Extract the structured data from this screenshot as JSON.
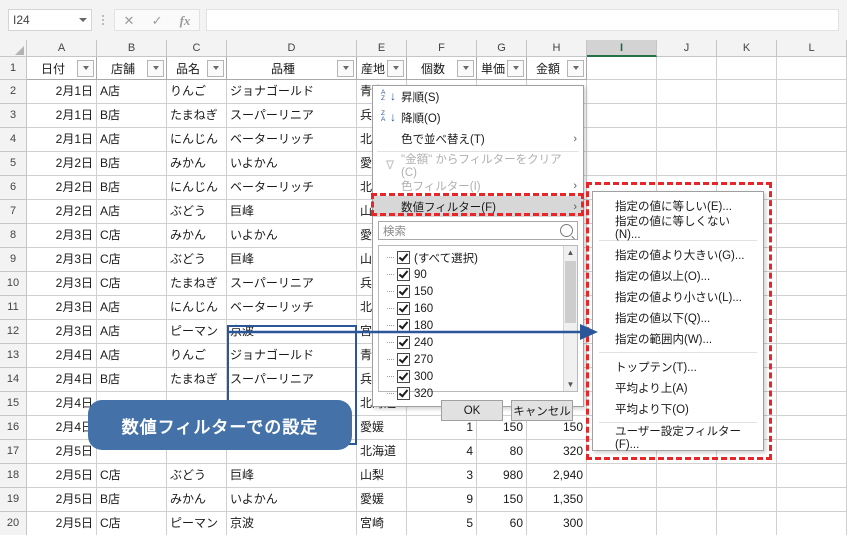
{
  "formula_bar": {
    "name_box_value": "I24",
    "formula_value": "",
    "cancel_icon": "close-icon",
    "confirm_icon": "check-icon",
    "function_icon": "fx-icon"
  },
  "grid": {
    "columns": [
      "A",
      "B",
      "C",
      "D",
      "E",
      "F",
      "G",
      "H",
      "I",
      "J",
      "K",
      "L"
    ],
    "selected_column": "I",
    "row_numbers": [
      1,
      2,
      3,
      4,
      5,
      6,
      7,
      8,
      9,
      10,
      11,
      12,
      13,
      14,
      15,
      16,
      17,
      18,
      19,
      20
    ],
    "headers": [
      "日付",
      "店舗",
      "品名",
      "品種",
      "産地",
      "個数",
      "単価",
      "金額"
    ],
    "rows": [
      {
        "r": 2,
        "date": "2月1日",
        "store": "A店",
        "item": "りんご",
        "variety": "ジョナゴールド",
        "origin": "青森",
        "qty": "",
        "price": "",
        "amount": ""
      },
      {
        "r": 3,
        "date": "2月1日",
        "store": "B店",
        "item": "たまねぎ",
        "variety": "スーパーリニア",
        "origin": "兵庫",
        "qty": "",
        "price": "",
        "amount": ""
      },
      {
        "r": 4,
        "date": "2月1日",
        "store": "A店",
        "item": "にんじん",
        "variety": "ベーターリッチ",
        "origin": "北海道",
        "qty": "",
        "price": "",
        "amount": ""
      },
      {
        "r": 5,
        "date": "2月2日",
        "store": "B店",
        "item": "みかん",
        "variety": "いよかん",
        "origin": "愛媛",
        "qty": "",
        "price": "",
        "amount": ""
      },
      {
        "r": 6,
        "date": "2月2日",
        "store": "B店",
        "item": "にんじん",
        "variety": "ベーターリッチ",
        "origin": "北海道",
        "qty": "",
        "price": "",
        "amount": ""
      },
      {
        "r": 7,
        "date": "2月2日",
        "store": "A店",
        "item": "ぶどう",
        "variety": "巨峰",
        "origin": "山梨",
        "qty": "",
        "price": "",
        "amount": ""
      },
      {
        "r": 8,
        "date": "2月3日",
        "store": "C店",
        "item": "みかん",
        "variety": "いよかん",
        "origin": "愛媛",
        "qty": "",
        "price": "",
        "amount": ""
      },
      {
        "r": 9,
        "date": "2月3日",
        "store": "C店",
        "item": "ぶどう",
        "variety": "巨峰",
        "origin": "山梨",
        "qty": "",
        "price": "",
        "amount": ""
      },
      {
        "r": 10,
        "date": "2月3日",
        "store": "C店",
        "item": "たまねぎ",
        "variety": "スーパーリニア",
        "origin": "兵庫",
        "qty": "",
        "price": "",
        "amount": ""
      },
      {
        "r": 11,
        "date": "2月3日",
        "store": "A店",
        "item": "にんじん",
        "variety": "ベーターリッチ",
        "origin": "北海道",
        "qty": "",
        "price": "",
        "amount": ""
      },
      {
        "r": 12,
        "date": "2月3日",
        "store": "A店",
        "item": "ピーマン",
        "variety": "京波",
        "origin": "宮崎",
        "qty": "",
        "price": "",
        "amount": ""
      },
      {
        "r": 13,
        "date": "2月4日",
        "store": "A店",
        "item": "りんご",
        "variety": "ジョナゴールド",
        "origin": "青森",
        "qty": "",
        "price": "",
        "amount": ""
      },
      {
        "r": 14,
        "date": "2月4日",
        "store": "B店",
        "item": "たまねぎ",
        "variety": "スーパーリニア",
        "origin": "兵庫",
        "qty": "",
        "price": "",
        "amount": ""
      },
      {
        "r": 15,
        "date": "2月4日",
        "store": "",
        "item": "",
        "variety": "",
        "origin": "北海道",
        "qty": "",
        "price": "",
        "amount": ""
      },
      {
        "r": 16,
        "date": "2月4日",
        "store": "",
        "item": "",
        "variety": "",
        "origin": "愛媛",
        "qty": "1",
        "price": "150",
        "amount": "150"
      },
      {
        "r": 17,
        "date": "2月5日",
        "store": "",
        "item": "",
        "variety": "",
        "origin": "北海道",
        "qty": "4",
        "price": "80",
        "amount": "320"
      },
      {
        "r": 18,
        "date": "2月5日",
        "store": "C店",
        "item": "ぶどう",
        "variety": "巨峰",
        "origin": "山梨",
        "qty": "3",
        "price": "980",
        "amount": "2,940"
      },
      {
        "r": 19,
        "date": "2月5日",
        "store": "B店",
        "item": "みかん",
        "variety": "いよかん",
        "origin": "愛媛",
        "qty": "9",
        "price": "150",
        "amount": "1,350"
      },
      {
        "r": 20,
        "date": "2月5日",
        "store": "C店",
        "item": "ピーマン",
        "variety": "京波",
        "origin": "宮崎",
        "qty": "5",
        "price": "60",
        "amount": "300"
      }
    ]
  },
  "filter_dropdown": {
    "menu_items": [
      {
        "label": "昇順(S)",
        "icon": "sort-ascending-icon",
        "submenu": false,
        "disabled": false,
        "highlight": false
      },
      {
        "label": "降順(O)",
        "icon": "sort-descending-icon",
        "submenu": false,
        "disabled": false,
        "highlight": false
      },
      {
        "label": "色で並べ替え(T)",
        "icon": "",
        "submenu": true,
        "disabled": false,
        "highlight": false
      },
      {
        "label": "\"金額\" からフィルターをクリア(C)",
        "icon": "clear-filter-icon",
        "submenu": false,
        "disabled": true,
        "highlight": false
      },
      {
        "label": "色フィルター(I)",
        "icon": "",
        "submenu": true,
        "disabled": true,
        "highlight": false
      },
      {
        "label": "数値フィルター(F)",
        "icon": "",
        "submenu": true,
        "disabled": false,
        "highlight": true
      }
    ],
    "search_placeholder": "検索",
    "search_icon": "magnifier-icon",
    "checkbox_items": [
      "(すべて選択)",
      "90",
      "150",
      "160",
      "180",
      "240",
      "270",
      "300",
      "320"
    ],
    "ok_label": "OK",
    "cancel_label": "キャンセル"
  },
  "number_filter_submenu": {
    "items": [
      {
        "label": "指定の値に等しい(E)...",
        "sep_after": false
      },
      {
        "label": "指定の値に等しくない(N)...",
        "sep_after": true
      },
      {
        "label": "指定の値より大きい(G)...",
        "sep_after": false
      },
      {
        "label": "指定の値以上(O)...",
        "sep_after": false
      },
      {
        "label": "指定の値より小さい(L)...",
        "sep_after": false
      },
      {
        "label": "指定の値以下(Q)...",
        "sep_after": false
      },
      {
        "label": "指定の範囲内(W)...",
        "sep_after": true
      },
      {
        "label": "トップテン(T)...",
        "sep_after": false
      },
      {
        "label": "平均より上(A)",
        "sep_after": false
      },
      {
        "label": "平均より下(O)",
        "sep_after": true
      },
      {
        "label": "ユーザー設定フィルター(F)...",
        "sep_after": false
      }
    ]
  },
  "annotations": {
    "callout_text": "数値フィルターでの設定",
    "callout_color": "#4472a8",
    "highlight_color": "#e8262a",
    "arrow_color": "#2b579a"
  }
}
